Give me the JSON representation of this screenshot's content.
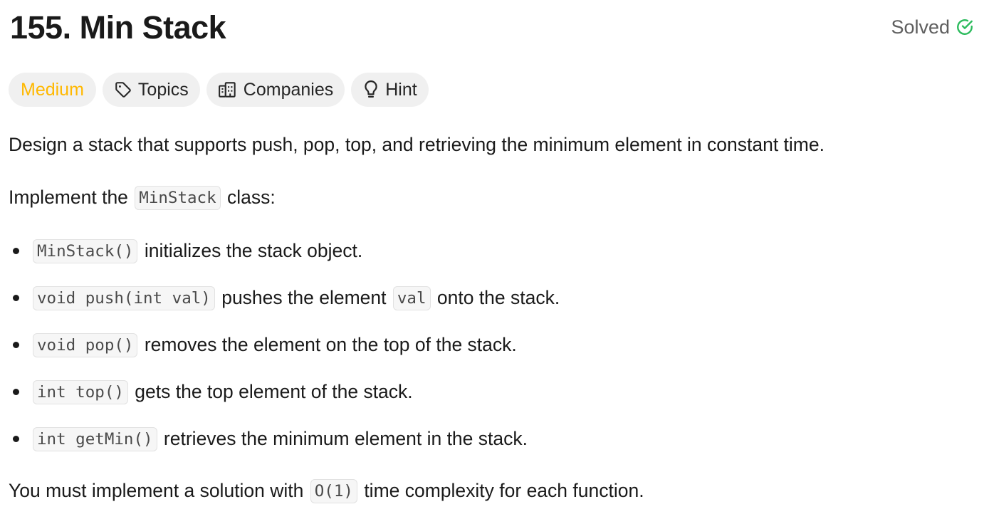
{
  "problem": {
    "title": "155. Min Stack",
    "status_label": "Solved"
  },
  "chips": {
    "difficulty": "Medium",
    "topics": "Topics",
    "companies": "Companies",
    "hint": "Hint"
  },
  "description": {
    "intro": "Design a stack that supports push, pop, top, and retrieving the minimum element in constant time.",
    "implement_prefix": "Implement the ",
    "implement_code": "MinStack",
    "implement_suffix": " class:",
    "methods": [
      {
        "code": "MinStack()",
        "text": " initializes the stack object."
      },
      {
        "code": "void push(int val)",
        "text": " pushes the element ",
        "code2": "val",
        "text2": " onto the stack."
      },
      {
        "code": "void pop()",
        "text": " removes the element on the top of the stack."
      },
      {
        "code": "int top()",
        "text": " gets the top element of the stack."
      },
      {
        "code": "int getMin()",
        "text": " retrieves the minimum element in the stack."
      }
    ],
    "complexity_prefix": "You must implement a solution with ",
    "complexity_code": "O(1)",
    "complexity_suffix": " time complexity for each function."
  },
  "colors": {
    "difficulty_medium": "#ffb800",
    "solved_check": "#2cbb5d",
    "chip_background": "#f0f0f0"
  },
  "icons": {
    "solved": "check-circle-icon",
    "topics": "tag-icon",
    "companies": "building-icon",
    "hint": "lightbulb-icon"
  }
}
